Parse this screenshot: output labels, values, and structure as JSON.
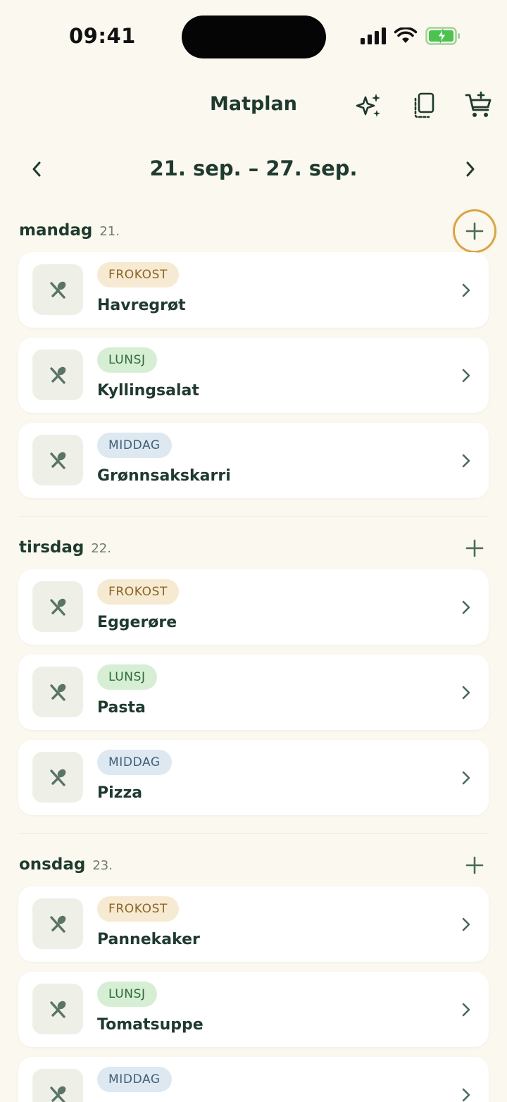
{
  "status": {
    "time": "09:41"
  },
  "header": {
    "title": "Matplan"
  },
  "week": {
    "label": "21. sep. – 27. sep."
  },
  "days": [
    {
      "name": "mandag",
      "date": "21.",
      "meals": [
        {
          "type": "FROKOST",
          "name": "Havregrøt"
        },
        {
          "type": "LUNSJ",
          "name": "Kyllingsalat"
        },
        {
          "type": "MIDDAG",
          "name": "Grønnsakskarri"
        }
      ]
    },
    {
      "name": "tirsdag",
      "date": "22.",
      "meals": [
        {
          "type": "FROKOST",
          "name": "Eggerøre"
        },
        {
          "type": "LUNSJ",
          "name": "Pasta"
        },
        {
          "type": "MIDDAG",
          "name": "Pizza"
        }
      ]
    },
    {
      "name": "onsdag",
      "date": "23.",
      "meals": [
        {
          "type": "FROKOST",
          "name": "Pannekaker"
        },
        {
          "type": "LUNSJ",
          "name": "Tomatsuppe"
        },
        {
          "type": "MIDDAG",
          "name": ""
        }
      ]
    }
  ],
  "icons": {
    "ai": "sparkles-icon",
    "copy": "copy-icon",
    "cart": "cart-add-icon",
    "prev": "chevron-left-icon",
    "next": "chevron-right-icon",
    "add": "plus-icon",
    "meal": "utensils-icon",
    "row": "chevron-right-icon"
  },
  "colors": {
    "accent": "#1f3a2e",
    "highlight": "#d9a545",
    "background": "#fbf8ef"
  }
}
